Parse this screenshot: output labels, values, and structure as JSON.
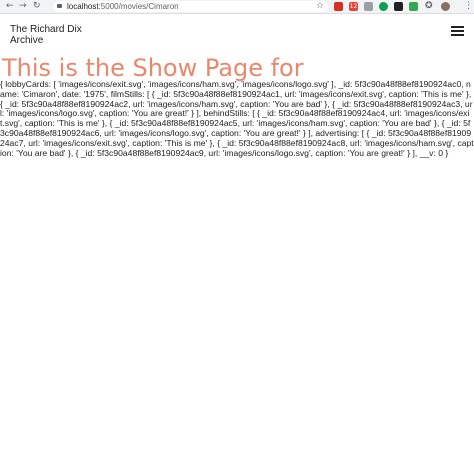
{
  "browser": {
    "url_host": "localhost",
    "url_path": ":5000/movies/Cimaron",
    "back_icon": "arrow-left",
    "forward_icon": "arrow-right",
    "reload_icon": "reload",
    "star_icon": "star",
    "menu_icon": "kebab",
    "extension_badge": "12"
  },
  "site": {
    "brand": "The Richard Dix Archive",
    "menu_icon": "hamburger"
  },
  "page": {
    "heading": "This is the Show Page for",
    "dump": "{ lobbyCards: [ 'images/icons/exit.svg', 'images/icons/ham.svg', 'images/icons/logo.svg' ], _id: 5f3c90a48f88ef8190924ac0, name: 'Cimaron', date: '1975', filmStills: [ { _id: 5f3c90a48f88ef8190924ac1, url: 'images/icons/exit.svg', caption: 'This is me' }, { _id: 5f3c90a48f88ef8190924ac2, url: 'images/icons/ham.svg', caption: 'You are bad' }, { _id: 5f3c90a48f88ef8190924ac3, url: 'images/icons/logo.svg', caption: 'You are great!' } ], behindStills: [ { _id: 5f3c90a48f88ef8190924ac4, url: 'images/icons/exit.svg', caption: 'This is me' }, { _id: 5f3c90a48f88ef8190924ac5, url: 'images/icons/ham.svg', caption: 'You are bad' }, { _id: 5f3c90a48f88ef8190924ac6, url: 'images/icons/logo.svg', caption: 'You are great!' } ], advertising: [ { _id: 5f3c90a48f88ef8190924ac7, url: 'images/icons/exit.svg', caption: 'This is me' }, { _id: 5f3c90a48f88ef8190924ac8, url: 'images/icons/ham.svg', caption: 'You are bad' }, { _id: 5f3c90a48f88ef8190924ac9, url: 'images/icons/logo.svg', caption: 'You are great!' } ], __v: 0 }"
  },
  "colors": {
    "heading": "#e9886a",
    "text": "#222222",
    "chrome_bg": "#f1f3f4"
  }
}
